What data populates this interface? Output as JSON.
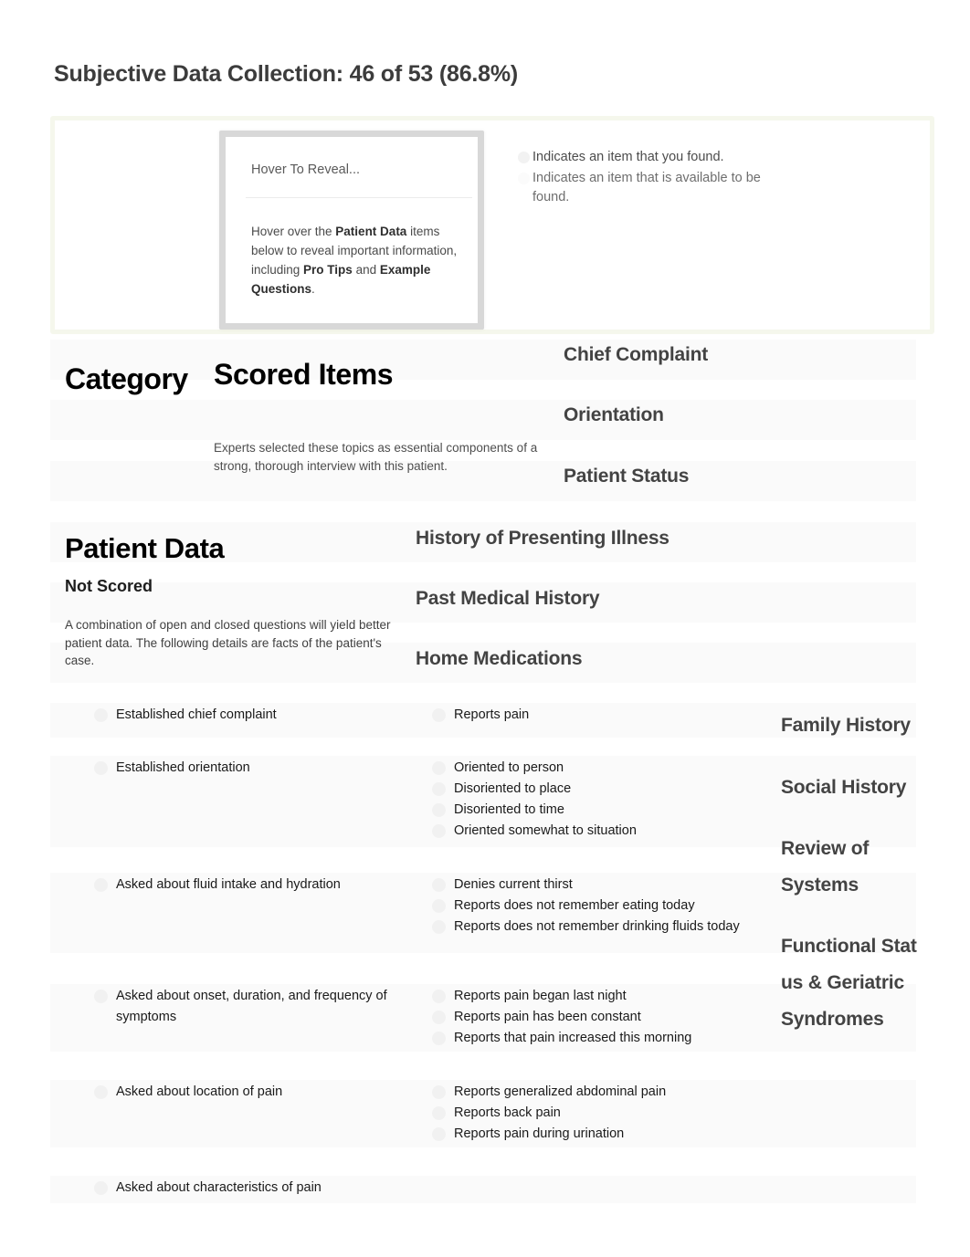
{
  "page": {
    "title": "Subjective Data Collection: 46 of 53 (86.8%)"
  },
  "hover_card": {
    "title": "Hover To Reveal...",
    "body_prefix": "Hover over the ",
    "body_bold_1": "Patient Data",
    "body_mid": " items below to reveal important information, including ",
    "body_bold_2": "Pro Tips",
    "body_and": " and ",
    "body_bold_3": "Example Questions",
    "body_suffix": "."
  },
  "legend": {
    "found": "Indicates an item that you found.",
    "available": "Indicates an item that is available to be found.",
    "found_icon": "filled-circle-icon",
    "available_icon": "hollow-circle-icon"
  },
  "scored_section": {
    "category_label": "Category",
    "title": "Scored Items",
    "description": "Experts selected these topics as essential components of a strong, thorough interview with this patient.",
    "categories": [
      "Chief Complaint",
      "Orientation",
      "Patient Status"
    ]
  },
  "patient_data_section": {
    "title": "Patient Data",
    "subtitle": "Not Scored",
    "description": "A combination of open and closed questions will yield better patient data. The following details are facts of the patient's case.",
    "middle_categories": [
      "History of Presenting Illness",
      "Past Medical History",
      "Home Medications"
    ],
    "right_categories": [
      "Family History",
      "Social History",
      "Review of Systems",
      "Functional Status & Geriatric Syndromes"
    ]
  },
  "rows": [
    {
      "questions": [
        "Established chief complaint"
      ],
      "findings": [
        "Reports pain"
      ]
    },
    {
      "questions": [
        "Established orientation"
      ],
      "findings": [
        "Oriented to person",
        "Disoriented to place",
        "Disoriented to time",
        "Oriented somewhat to situation"
      ]
    },
    {
      "questions": [
        "Asked about fluid intake and hydration"
      ],
      "findings": [
        "Denies current thirst",
        "Reports does not remember eating today",
        "Reports does not remember drinking fluids today"
      ]
    },
    {
      "questions": [
        "Asked about onset, duration, and frequency of symptoms"
      ],
      "findings": [
        "Reports pain began last night",
        "Reports pain has been constant",
        "Reports that pain increased this morning"
      ]
    },
    {
      "questions": [
        "Asked about location of pain"
      ],
      "findings": [
        "Reports generalized abdominal pain",
        "Reports back pain",
        "Reports pain during urination"
      ]
    },
    {
      "questions": [
        "Asked about characteristics of pain"
      ],
      "findings": []
    }
  ],
  "colors": {
    "panel_border": "#f5f7ec",
    "card_border": "#d8d8d8",
    "stripe": "#fafafa",
    "heading": "#434343",
    "text": "#1a1a1a"
  }
}
